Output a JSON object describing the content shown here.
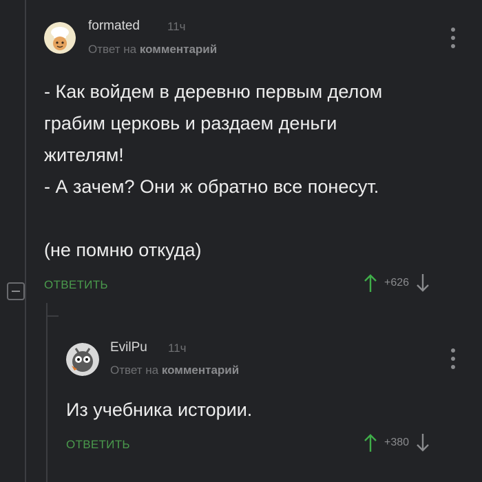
{
  "comments": [
    {
      "author": "formated",
      "time": "11ч",
      "reply_prefix": "Ответ на",
      "reply_target": "комментарий",
      "lines": [
        "- Как войдем в деревню первым делом",
        "грабим церковь и раздаем деньги",
        "жителям!",
        "- А зачем? Они ж обратно все понесут.",
        "",
        "(не помню откуда)"
      ],
      "reply_label": "ОТВЕТИТЬ",
      "score": "+626"
    },
    {
      "author": "EvilPu",
      "time": "11ч",
      "reply_prefix": "Ответ на",
      "reply_target": "комментарий",
      "lines": [
        "Из учебника истории."
      ],
      "reply_label": "ОТВЕТИТЬ",
      "score": "+380"
    }
  ],
  "colors": {
    "background": "#222326",
    "reply_green": "#4a9a4c",
    "vote_green": "#3fae49",
    "muted": "#8a8b8e"
  },
  "icons": {
    "collapse": "minus-box-icon",
    "upvote": "arrow-up-icon",
    "downvote": "arrow-down-icon",
    "menu": "kebab-menu-icon"
  }
}
